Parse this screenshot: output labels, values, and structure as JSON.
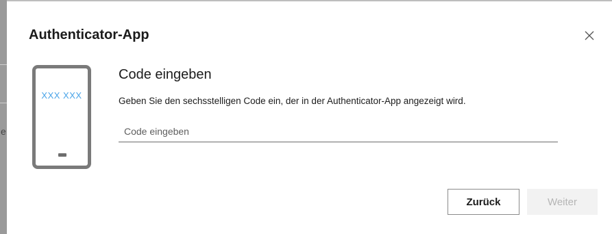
{
  "background": {
    "edge_char": "e"
  },
  "dialog": {
    "title": "Authenticator-App",
    "close_icon": "close-icon",
    "illustration": {
      "icon": "phone-icon",
      "code_text": "XXX XXX",
      "code_color": "#4aa4e8"
    },
    "heading": "Code eingeben",
    "description": "Geben Sie den sechsstelligen Code ein, der in der Authenticator-App angezeigt wird.",
    "code_input": {
      "value": "",
      "placeholder": "Code eingeben"
    },
    "buttons": {
      "back_label": "Zurück",
      "next_label": "Weiter",
      "next_disabled": true
    }
  }
}
